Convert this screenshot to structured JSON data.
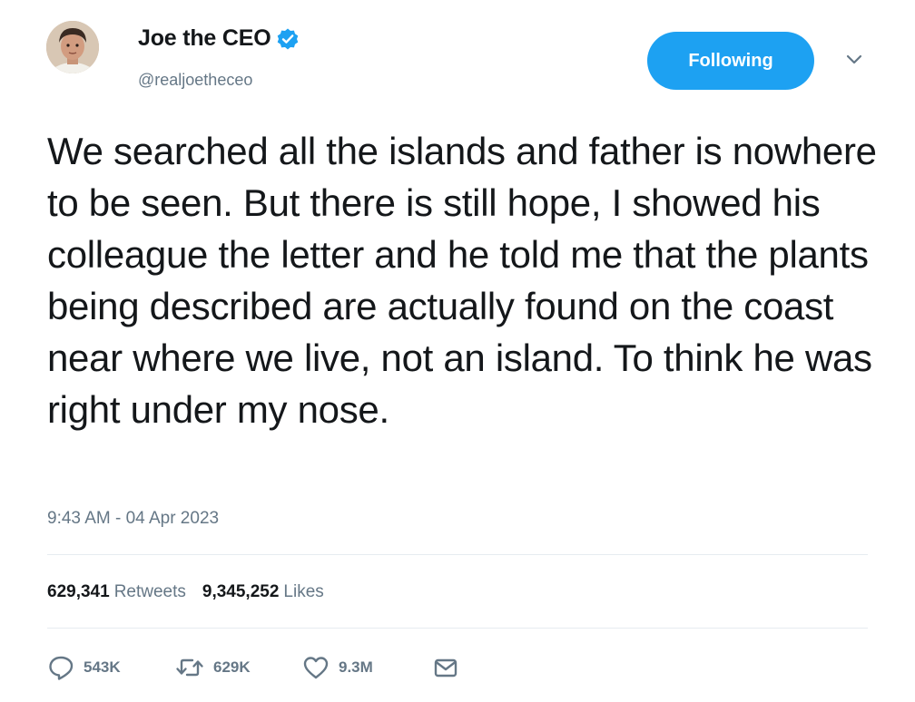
{
  "user": {
    "display_name": "Joe the CEO",
    "handle": "@realjoetheceo",
    "verified": true
  },
  "follow_button": {
    "label": "Following"
  },
  "tweet": {
    "text": "We searched all the islands and father is nowhere to be seen. But there is still hope, I showed his colleague the letter and he told me that the plants being described are actually found on the coast near where we live, not an island. To think he was right under my nose.",
    "timestamp": "9:43 AM - 04 Apr 2023"
  },
  "stats": {
    "retweets_count": "629,341",
    "retweets_label": "Retweets",
    "likes_count": "9,345,252",
    "likes_label": "Likes"
  },
  "actions": {
    "reply": {
      "icon": "reply-icon",
      "count": "543K"
    },
    "retweet": {
      "icon": "retweet-icon",
      "count": "629K"
    },
    "like": {
      "icon": "heart-icon",
      "count": "9.3M"
    },
    "message": {
      "icon": "envelope-icon"
    }
  },
  "colors": {
    "accent": "#1da1f2",
    "text_primary": "#14171a",
    "text_secondary": "#657786",
    "divider": "#e6ecf0"
  }
}
